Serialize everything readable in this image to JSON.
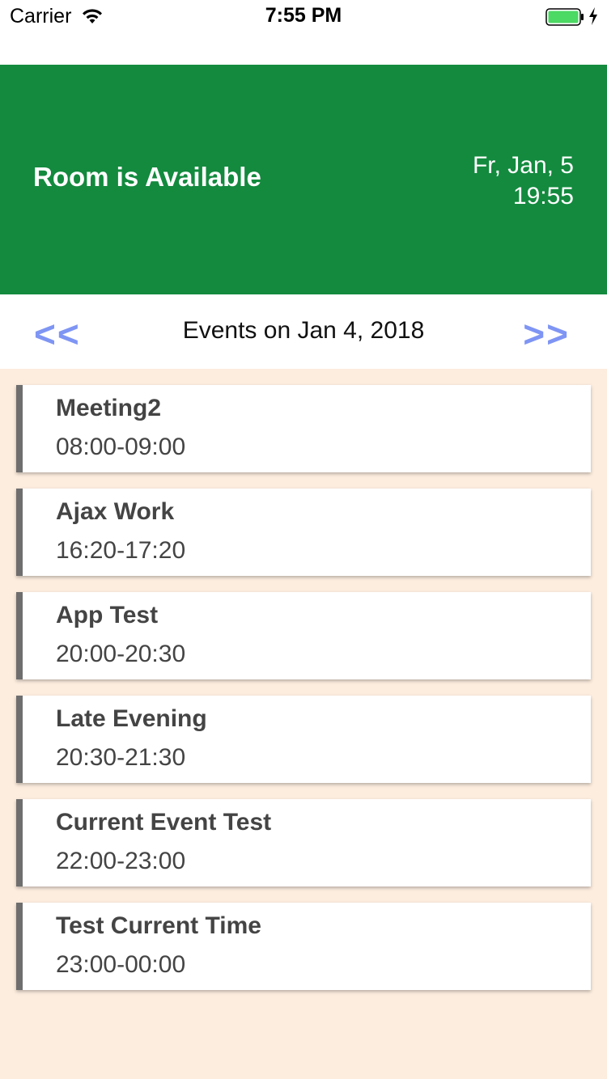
{
  "status_bar": {
    "carrier": "Carrier",
    "time": "7:55 PM",
    "battery_color": "#4cd964"
  },
  "header": {
    "room_status": "Room is Available",
    "date": "Fr, Jan, 5",
    "time": "19:55",
    "background": "#138a3e"
  },
  "date_nav": {
    "prev_label": "<<",
    "next_label": ">>",
    "title": "Events on Jan 4, 2018",
    "arrow_color": "#7f95f4"
  },
  "events": [
    {
      "title": "Meeting2",
      "time": "08:00-09:00"
    },
    {
      "title": "Ajax Work",
      "time": "16:20-17:20"
    },
    {
      "title": "App Test",
      "time": "20:00-20:30"
    },
    {
      "title": "Late Evening",
      "time": "20:30-21:30"
    },
    {
      "title": "Current Event Test",
      "time": "22:00-23:00"
    },
    {
      "title": "Test Current Time",
      "time": "23:00-00:00"
    }
  ],
  "colors": {
    "list_background": "#fdeddf",
    "card_accent": "#6e6e6e"
  }
}
